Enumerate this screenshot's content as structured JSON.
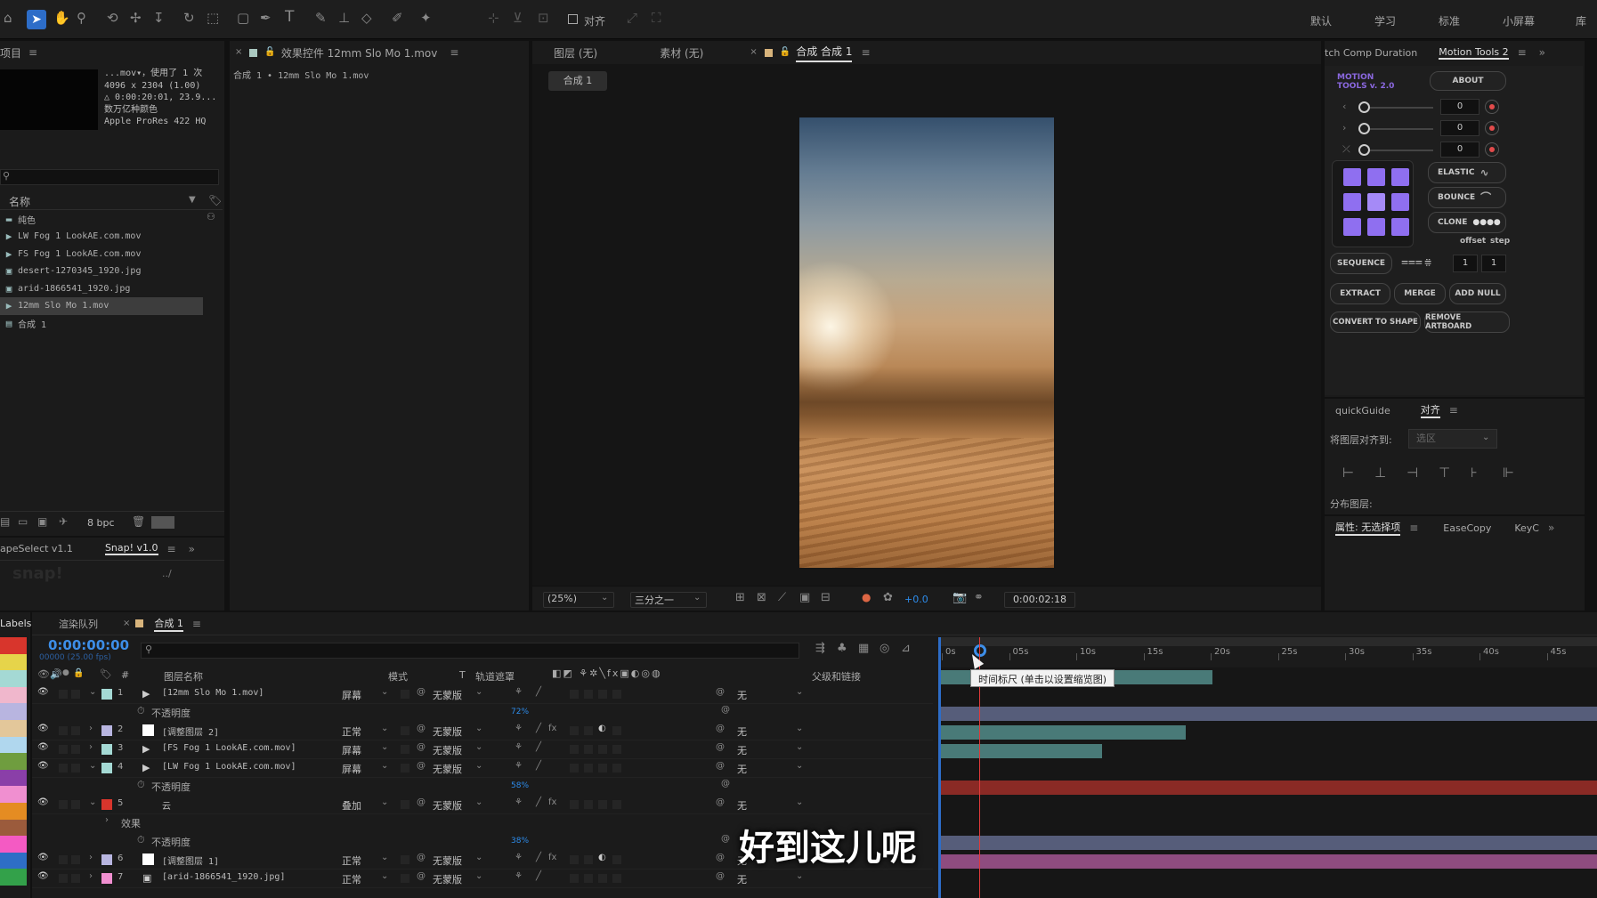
{
  "toolbar": {
    "workspaces": [
      "默认",
      "学习",
      "标准",
      "小屏幕",
      "库"
    ],
    "align_label": "对齐"
  },
  "project": {
    "title": "项目",
    "info_lines": [
      "...mov▾，使用了 1 次",
      "4096 x 2304 (1.00)",
      "△ 0:00:20:01, 23.9...",
      "数万亿种颜色",
      "Apple ProRes 422 HQ"
    ],
    "search_placeholder": "",
    "column_name": "名称",
    "items": [
      {
        "name": "纯色",
        "type": "folder"
      },
      {
        "name": "LW Fog 1 LookAE.com.mov",
        "type": "video"
      },
      {
        "name": "FS Fog 1 LookAE.com.mov",
        "type": "video"
      },
      {
        "name": "desert-1270345_1920.jpg",
        "type": "image"
      },
      {
        "name": "arid-1866541_1920.jpg",
        "type": "image"
      },
      {
        "name": "12mm Slo Mo 1.mov",
        "type": "video"
      },
      {
        "name": "合成 1",
        "type": "comp"
      }
    ],
    "bpc": "8 bpc"
  },
  "effects": {
    "tab": "效果控件 12mm Slo Mo 1.mov",
    "path": "合成 1 • 12mm Slo Mo 1.mov"
  },
  "snap": {
    "tab1": "apeSelect v1.1",
    "tab2": "Snap! v1.0",
    "logo": "snap!",
    "path": "../"
  },
  "viewer": {
    "tabs": [
      "图层 (无)",
      "素材 (无)",
      "合成 合成 1"
    ],
    "comp_chip": "合成 1",
    "zoom": "(25%)",
    "resolution": "三分之一",
    "exposure": "+0.0",
    "timecode": "0:00:02:18"
  },
  "motion_tools": {
    "tab1": "tch Comp Duration",
    "tab2": "Motion Tools 2",
    "logo": "MOTION TOOLS v. 2.0",
    "about": "ABOUT",
    "values": [
      "0",
      "0",
      "0"
    ],
    "buttons": {
      "elastic": "ELASTIC",
      "bounce": "BOUNCE",
      "clone": "CLONE",
      "offset": "offset",
      "step": "step",
      "sequence": "SEQUENCE",
      "seq_val1": "1",
      "seq_val2": "1",
      "extract": "EXTRACT",
      "merge": "MERGE",
      "add_null": "ADD NULL",
      "convert": "CONVERT TO SHAPE",
      "remove_artboard": "REMOVE ARTBOARD"
    }
  },
  "align_panel": {
    "tab1": "quickGuide",
    "tab2": "对齐",
    "align_to_label": "将图层对齐到:",
    "align_to_value": "选区",
    "distribute_label": "分布图层:"
  },
  "props_panel": {
    "tab1": "属性: 无选择项",
    "tab2": "EaseCopy",
    "tab3": "KeyC"
  },
  "timeline": {
    "labels_tab": "Labels",
    "render_tab": "渲染队列",
    "comp_tab": "合成 1",
    "timecode": "0:00:00:00",
    "frames": "00000 (25.00 fps)",
    "columns": {
      "hash": "#",
      "name": "图层名称",
      "mode": "模式",
      "t": "T",
      "matte": "轨道遮罩",
      "parent": "父级和链接"
    },
    "ruler": [
      "0s",
      "05s",
      "10s",
      "15s",
      "20s",
      "25s",
      "30s",
      "35s",
      "40s",
      "45s"
    ],
    "tooltip": "时间标尺 (单击以设置缩览图)",
    "opacity_label": "不透明度",
    "effects_label": "效果",
    "layers": [
      {
        "num": "1",
        "name": "[12mm Slo Mo 1.mov]",
        "mode": "屏幕",
        "matte": "无蒙版",
        "parent": "无",
        "color": "#a4d9d4",
        "opacity": "72%"
      },
      {
        "num": "2",
        "name": "[调整图层 2]",
        "mode": "正常",
        "matte": "无蒙版",
        "parent": "无",
        "color": "#b8b5e0"
      },
      {
        "num": "3",
        "name": "[FS Fog 1 LookAE.com.mov]",
        "mode": "屏幕",
        "matte": "无蒙版",
        "parent": "无",
        "color": "#a4d9d4"
      },
      {
        "num": "4",
        "name": "[LW Fog 1 LookAE.com.mov]",
        "mode": "屏幕",
        "matte": "无蒙版",
        "parent": "无",
        "color": "#a4d9d4",
        "opacity": "58%"
      },
      {
        "num": "5",
        "name": "云",
        "mode": "叠加",
        "matte": "无蒙版",
        "parent": "无",
        "color": "#d8352c",
        "opacity": "38%"
      },
      {
        "num": "6",
        "name": "[调整图层 1]",
        "mode": "正常",
        "matte": "无蒙版",
        "parent": "无",
        "color": "#b8b5e0"
      },
      {
        "num": "7",
        "name": "[arid-1866541_1920.jpg]",
        "mode": "正常",
        "matte": "无蒙版",
        "parent": "无",
        "color": "#f08fd0"
      }
    ]
  },
  "subtitle": "好到这儿呢",
  "colors": {
    "accent_blue": "#2d8ceb",
    "label_swatches": [
      "#d8352c",
      "#e6d44a",
      "#a4d9d4",
      "#f0b7cc",
      "#b8b5e0",
      "#e3c79a",
      "#b0d7ee",
      "#6f9d3f",
      "#8a3fa8",
      "#f08fd0",
      "#e58c22",
      "#9b5b3c",
      "#f45ac3",
      "#2e6ec6",
      "#33a14a"
    ]
  }
}
